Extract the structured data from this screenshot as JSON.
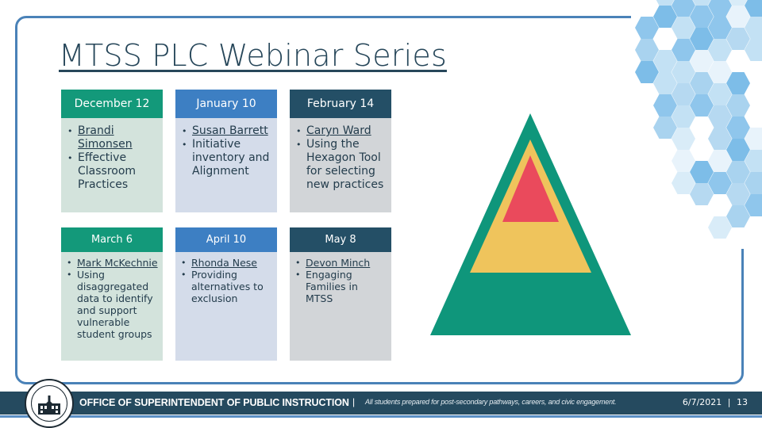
{
  "slide": {
    "title": "MTSS PLC Webinar Series"
  },
  "sessions": [
    {
      "date": "December 12",
      "presenter": "Brandi Simonsen",
      "topic": "Effective Classroom Practices",
      "theme": "green"
    },
    {
      "date": "January 10",
      "presenter": "Susan Barrett",
      "topic": "Initiative inventory and Alignment",
      "theme": "blue"
    },
    {
      "date": "February 14",
      "presenter": "Caryn Ward",
      "topic": "Using the Hexagon Tool for selecting new practices",
      "theme": "navy"
    },
    {
      "date": "March 6",
      "presenter": "Mark McKechnie",
      "topic": "Using disaggregated data to identify and support vulnerable student groups",
      "theme": "green"
    },
    {
      "date": "April 10",
      "presenter": "Rhonda Nese",
      "topic": "Providing alternatives to exclusion",
      "theme": "blue"
    },
    {
      "date": "May 8",
      "presenter": "Devon Minch",
      "topic": "Engaging Families in MTSS",
      "theme": "navy"
    }
  ],
  "pyramid": {
    "tiers": [
      {
        "name": "tier-1",
        "color": "#0f967b"
      },
      {
        "name": "tier-2",
        "color": "#efc45c"
      },
      {
        "name": "tier-3",
        "color": "#ea4a5c"
      }
    ]
  },
  "colors": {
    "frame": "#4a82b8",
    "title": "#27475a",
    "hex_palette": [
      "#a9d3ef",
      "#c3e1f4",
      "#d9ecf8",
      "#8fc6ec",
      "#7dbde8",
      "#e8f3fb",
      "#b6d9f1"
    ]
  },
  "footer": {
    "organization": "OFFICE OF SUPERINTENDENT OF PUBLIC INSTRUCTION",
    "separator": "|",
    "tagline": "All students prepared for post-secondary pathways, careers, and civic engagement.",
    "date": "6/7/2021",
    "page_separator": "|",
    "page_number": "13"
  }
}
